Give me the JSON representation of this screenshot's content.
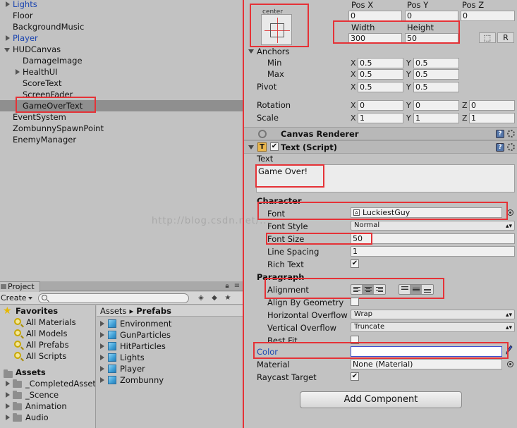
{
  "hierarchy": {
    "items": [
      {
        "label": "Lights",
        "blue": true,
        "arrow": "right",
        "indent": 0
      },
      {
        "label": "Floor",
        "blue": false,
        "arrow": "",
        "indent": 0
      },
      {
        "label": "BackgroundMusic",
        "blue": false,
        "arrow": "",
        "indent": 0
      },
      {
        "label": "Player",
        "blue": true,
        "arrow": "right",
        "indent": 0
      },
      {
        "label": "HUDCanvas",
        "blue": false,
        "arrow": "down",
        "indent": 0
      },
      {
        "label": "DamageImage",
        "blue": false,
        "arrow": "",
        "indent": 1
      },
      {
        "label": "HealthUI",
        "blue": false,
        "arrow": "right",
        "indent": 1
      },
      {
        "label": "ScoreText",
        "blue": false,
        "arrow": "",
        "indent": 1
      },
      {
        "label": "ScreenFader",
        "blue": false,
        "arrow": "",
        "indent": 1
      },
      {
        "label": "GameOverText",
        "blue": false,
        "arrow": "",
        "indent": 1,
        "selected": true
      },
      {
        "label": "EventSystem",
        "blue": false,
        "arrow": "",
        "indent": 0
      },
      {
        "label": "ZombunnySpawnPoint",
        "blue": false,
        "arrow": "",
        "indent": 0
      },
      {
        "label": "EnemyManager",
        "blue": false,
        "arrow": "",
        "indent": 0
      }
    ]
  },
  "project": {
    "tab_label": "Project",
    "create_label": "Create",
    "favorites": {
      "title": "Favorites",
      "items": [
        "All Materials",
        "All Models",
        "All Prefabs",
        "All Scripts"
      ]
    },
    "assets": {
      "title": "Assets",
      "items": [
        "_CompletedAsset",
        "_Scence",
        "Animation",
        "Audio"
      ]
    },
    "breadcrumb": {
      "root": "Assets",
      "separator": "▸",
      "current": "Prefabs"
    },
    "prefabs": [
      "Environment",
      "GunParticles",
      "HitParticles",
      "Lights",
      "Player",
      "Zombunny"
    ]
  },
  "inspector": {
    "rect": {
      "anchor_preset": "center",
      "pos_x_label": "Pos X",
      "pos_y_label": "Pos Y",
      "pos_z_label": "Pos Z",
      "pos_x": "0",
      "pos_y": "0",
      "pos_z": "0",
      "width_label": "Width",
      "height_label": "Height",
      "width": "300",
      "height": "50",
      "blueprint_btn": "⬚",
      "raw_btn": "R",
      "anchors_label": "Anchors",
      "min_label": "Min",
      "max_label": "Max",
      "min_x": "0.5",
      "min_y": "0.5",
      "max_x": "0.5",
      "max_y": "0.5",
      "pivot_label": "Pivot",
      "pivot_x": "0.5",
      "pivot_y": "0.5",
      "rotation_label": "Rotation",
      "rot_x": "0",
      "rot_y": "0",
      "rot_z": "0",
      "scale_label": "Scale",
      "scale_x": "1",
      "scale_y": "1",
      "scale_z": "1",
      "axis_x": "X",
      "axis_y": "Y",
      "axis_z": "Z"
    },
    "canvas_renderer": {
      "title": "Canvas Renderer"
    },
    "text_script": {
      "title": "Text (Script)",
      "enabled": true,
      "text_label": "Text",
      "text_value": "Game Over!",
      "character_header": "Character",
      "font_label": "Font",
      "font_value": "LuckiestGuy",
      "font_style_label": "Font Style",
      "font_style_value": "Normal",
      "font_size_label": "Font Size",
      "font_size_value": "50",
      "line_spacing_label": "Line Spacing",
      "line_spacing_value": "1",
      "rich_text_label": "Rich Text",
      "rich_text": true,
      "paragraph_header": "Paragraph",
      "alignment_label": "Alignment",
      "horizontal_align": "center",
      "vertical_align": "middle",
      "align_by_geometry_label": "Align By Geometry",
      "align_by_geometry": false,
      "h_overflow_label": "Horizontal Overflow",
      "h_overflow_value": "Wrap",
      "v_overflow_label": "Vertical Overflow",
      "v_overflow_value": "Truncate",
      "best_fit_label": "Best Fit",
      "best_fit": false,
      "color_label": "Color",
      "color_value": "#ffffff",
      "material_label": "Material",
      "material_value": "None (Material)",
      "raycast_label": "Raycast Target",
      "raycast": true
    },
    "add_component_label": "Add Component"
  },
  "watermark": "http://blog.csdn.net/...",
  "colors": {
    "panel_bg": "#c2c2c2",
    "selection_bg": "#8f8f8f",
    "highlight_box": "#e53237",
    "blue_text": "#1b45b0",
    "color_field_border": "#3c4fd0"
  }
}
